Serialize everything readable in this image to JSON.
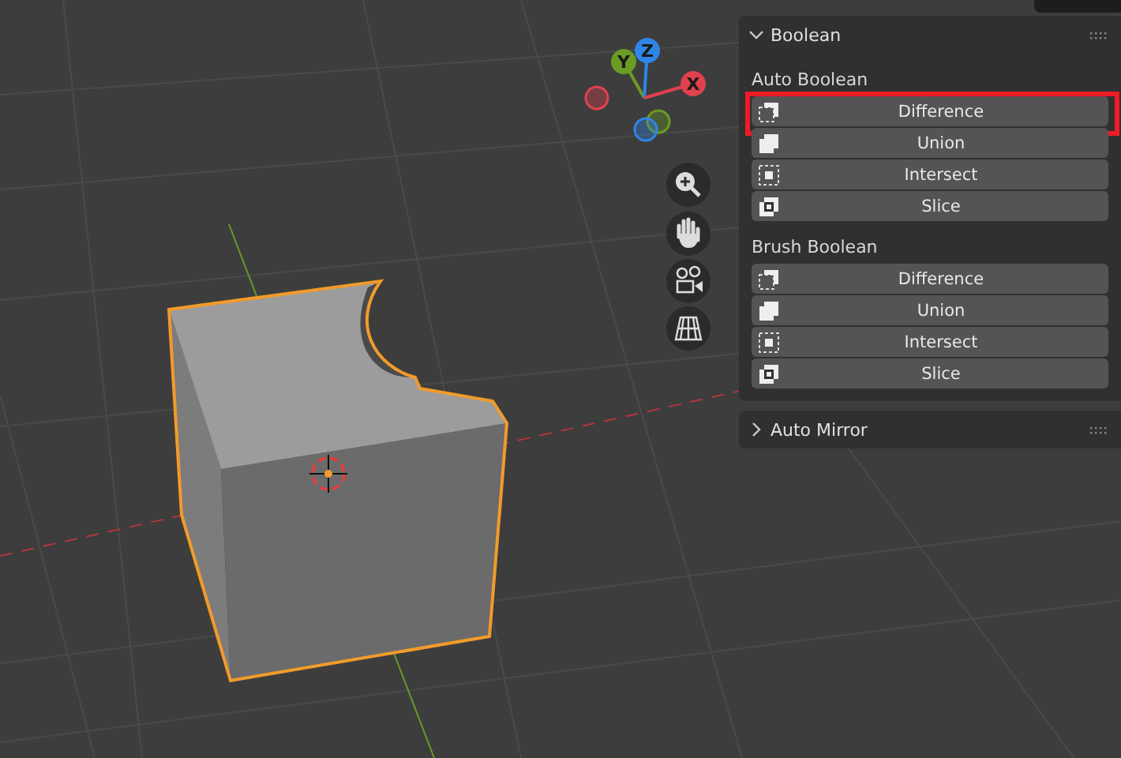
{
  "gizmo": {
    "axes": [
      {
        "label": "Y",
        "kind": "y"
      },
      {
        "label": "Z",
        "kind": "z"
      },
      {
        "label": "X",
        "kind": "x"
      }
    ]
  },
  "panels": [
    {
      "title": "Boolean",
      "expanded": true,
      "groups": [
        {
          "label": "Auto Boolean",
          "buttons": [
            {
              "label": "Difference",
              "kind": "difference",
              "highlighted": true
            },
            {
              "label": "Union",
              "kind": "union",
              "highlighted": false
            },
            {
              "label": "Intersect",
              "kind": "intersect",
              "highlighted": false
            },
            {
              "label": "Slice",
              "kind": "slice",
              "highlighted": false
            }
          ]
        },
        {
          "label": "Brush Boolean",
          "buttons": [
            {
              "label": "Difference",
              "kind": "difference",
              "highlighted": false
            },
            {
              "label": "Union",
              "kind": "union",
              "highlighted": false
            },
            {
              "label": "Intersect",
              "kind": "intersect",
              "highlighted": false
            },
            {
              "label": "Slice",
              "kind": "slice",
              "highlighted": false
            }
          ]
        }
      ]
    },
    {
      "title": "Auto Mirror",
      "expanded": false
    }
  ]
}
